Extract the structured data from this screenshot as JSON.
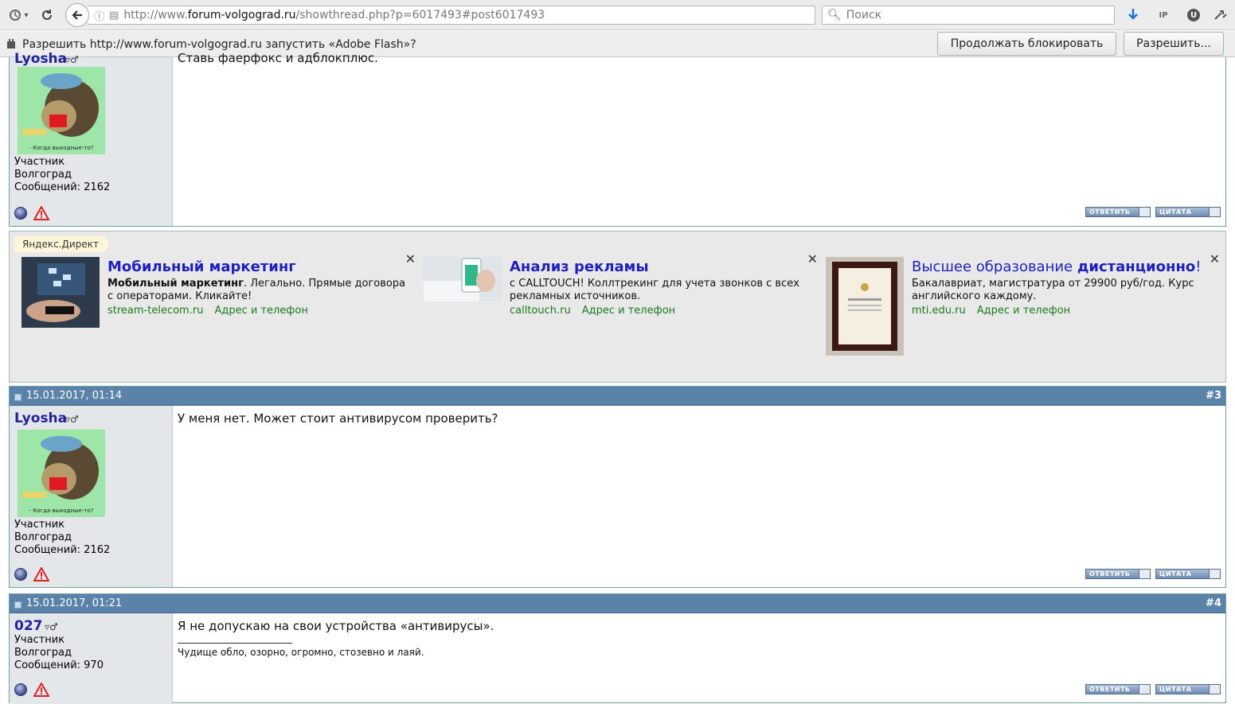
{
  "browser": {
    "url_prefix": "http://www.",
    "url_host": "forum-volgograd.ru",
    "url_path": "/showthread.php?p=6017493#post6017493",
    "search_placeholder": "Поиск",
    "ext_ip": "IP",
    "ext_u": "U"
  },
  "flash_bar": {
    "message": "Разрешить http://www.forum-volgograd.ru запустить «Adobe Flash»?",
    "keep_block_label": "Продолжать блокировать",
    "allow_label": "Разрешить..."
  },
  "colors": {
    "post_header": "#5b83aa",
    "username": "#22229b",
    "ad_title": "#2020c0",
    "ad_link": "#1a7a1a"
  },
  "post_top": {
    "username": "Lyosha",
    "message": "Ставь фаерфокс и адблокплюс.",
    "role": "Участник",
    "city": "Волгоград",
    "posts": "Сообщений: 2162",
    "avatar_caption": "- Когда выходные-то?"
  },
  "ads": {
    "label": "Яндекс.Директ",
    "items": [
      {
        "title": "Мобильный маркетинг",
        "desc_bold": "Мобильный маркетинг",
        "desc": ". Легально. Прямые договора с операторами. Кликайте!",
        "domain": "stream-telecom.ru",
        "address": "Адрес и телефон"
      },
      {
        "title": "Анализ рекламы",
        "desc": "с CALLTOUCH! Коллтрекинг для учета звонков с всех рекламных источников.",
        "domain": "calltouch.ru",
        "address": "Адрес и телефон"
      },
      {
        "title_plain": "Высшее образование ",
        "title_bold": "дистанционно",
        "title_end": "!",
        "desc": "Бакалавриат, магистратура от 29900 руб/год. Курс английского каждому.",
        "domain": "mti.edu.ru",
        "address": "Адрес и телефон"
      }
    ]
  },
  "post3": {
    "date": "15.01.2017, 01:14",
    "num": "#3",
    "username": "Lyosha",
    "message": "У меня нет. Может стоит антивирусом проверить?",
    "role": "Участник",
    "city": "Волгоград",
    "posts": "Сообщений: 2162",
    "avatar_caption": "- Когда выходные-то?"
  },
  "post4": {
    "date": "15.01.2017, 01:21",
    "num": "#4",
    "username": "027",
    "message": "Я не допускаю на свои устройства «антивирусы».",
    "signature": "Чудище обло, озорно, огромно, стозевно и лаяй.",
    "role": "Участник",
    "city": "Волгоград",
    "posts": "Сообщений: 970"
  },
  "buttons": {
    "reply": "ОТВЕТИТЬ",
    "quote": "ЦИТАТА"
  }
}
